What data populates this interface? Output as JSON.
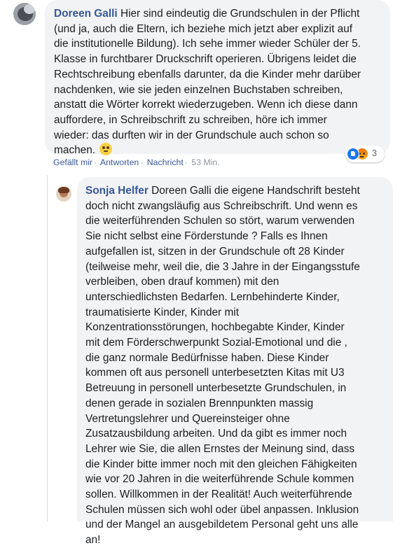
{
  "comments": [
    {
      "author": "Doreen Galli",
      "text": "Hier sind eindeutig die Grundschulen in der Pflicht\n(und ja, auch die Eltern, ich beziehe mich jetzt aber explizit auf\ndie institutionelle Bildung). Ich sehe immer wieder Schüler der 5.\nKlasse in furchtbarer Druckschrift operieren. Übrigens leidet die\nRechtschreibung ebenfalls darunter, da die Kinder mehr darüber\nnachdenken, wie sie jeden einzelnen Buchstaben schreiben,\nanstatt die Wörter korrekt wiederzugeben. Wenn ich diese dann\nauffordere, in Schreibschrift zu schreiben, höre ich immer\nwieder: das durften wir in der Grundschule auch schon so\nmachen.",
      "emoji_icon": "face-with-rolling-eyes-emoji",
      "actions": {
        "like": "Gefällt mir",
        "reply": "Antworten",
        "message": "Nachricht",
        "time": "53 Min."
      },
      "reactions": {
        "icons": [
          "like",
          "angry"
        ],
        "count": "3"
      }
    },
    {
      "author": "Sonja Helfer",
      "text": "Doreen Galli die eigene Handschrift besteht\ndoch nicht zwangsläufig aus Schreibschrift. Und wenn es\ndie weiterführenden Schulen so stört, warum verwenden\nSie nicht selbst eine Förderstunde ? Falls es Ihnen\naufgefallen ist, sitzen in der Grundschule oft 28 Kinder\n(teilweise mehr, weil die, die 3 Jahre in der Eingangsstufe\nverbleiben, oben drauf kommen) mit den\nunterschiedlichsten Bedarfen. Lernbehinderte Kinder,\ntraumatisierte Kinder, Kinder mit\nKonzentrationsstörungen, hochbegabte Kinder, Kinder\nmit dem Förderschwerpunkt Sozial-Emotional und die ,\ndie ganz normale Bedürfnisse haben. Diese Kinder\nkommen oft aus personell unterbesetzten Kitas mit U3\nBetreuung in personell unterbesetzte Grundschulen, in\ndenen gerade in sozialen Brennpunkten massig\nVertretungslehrer und Quereinsteiger ohne\nZusatzausbildung arbeiten. Und da gibt es immer noch\nLehrer wie Sie, die allen Ernstes der Meinung sind, dass\ndie Kinder bitte immer noch mit den gleichen Fähigkeiten\nwie vor 20 Jahren in die weiterführende Schule kommen\nsollen. Willkommen in der Realität! Auch weiterführende\nSchulen müssen sich wohl oder übel anpassen. Inklusion\nund der Mangel an ausgebildetem Personal geht uns alle\nan!"
    }
  ],
  "actions_separator": "·",
  "colors": {
    "author": "#385898",
    "bubble": "#f2f3f5",
    "text": "#1c1e21",
    "meta": "#90949c"
  }
}
